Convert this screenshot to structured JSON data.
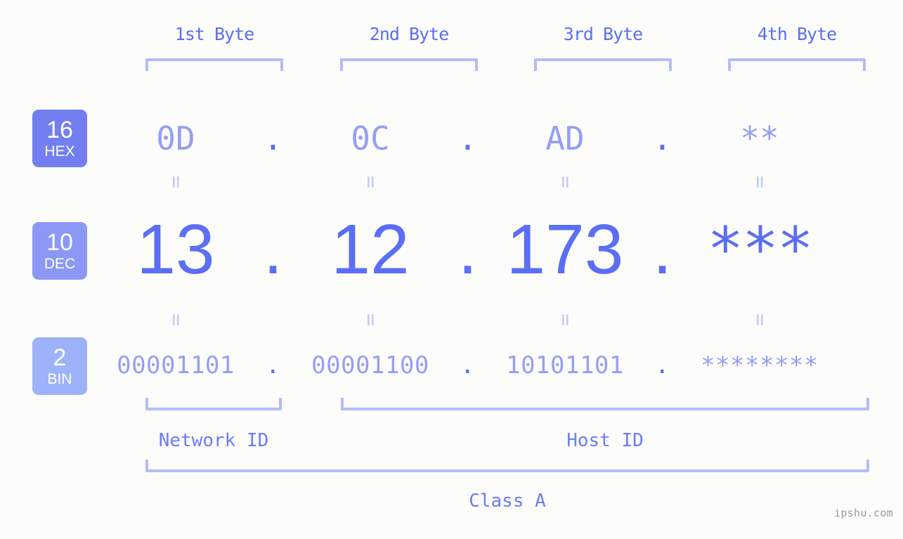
{
  "watermark": "ipshu.com",
  "byte_headers": [
    {
      "label": "1st Byte"
    },
    {
      "label": "2nd Byte"
    },
    {
      "label": "3rd Byte"
    },
    {
      "label": "4th Byte"
    }
  ],
  "bases": [
    {
      "number": "16",
      "name": "HEX",
      "color": "#737ef0"
    },
    {
      "number": "10",
      "name": "DEC",
      "color": "#8d97f5"
    },
    {
      "number": "2",
      "name": "BIN",
      "color": "#9db2fa"
    }
  ],
  "separator": ".",
  "equals": "=",
  "rows": {
    "hex": {
      "values": [
        "0D",
        "0C",
        "AD",
        "**"
      ]
    },
    "dec": {
      "values": [
        "13",
        "12",
        "173",
        "***"
      ]
    },
    "bin": {
      "values": [
        "00001101",
        "00001100",
        "10101101",
        "********"
      ]
    }
  },
  "sections": {
    "network_id": "Network ID",
    "host_id": "Host ID",
    "class": "Class A"
  },
  "colors": {
    "background": "#fcfdfa",
    "accent_strong": "#5b6ef5",
    "accent_mid": "#959ef6",
    "accent_light": "#b3bcfb",
    "equals": "#c3cafb",
    "watermark": "#9a9a9a"
  }
}
